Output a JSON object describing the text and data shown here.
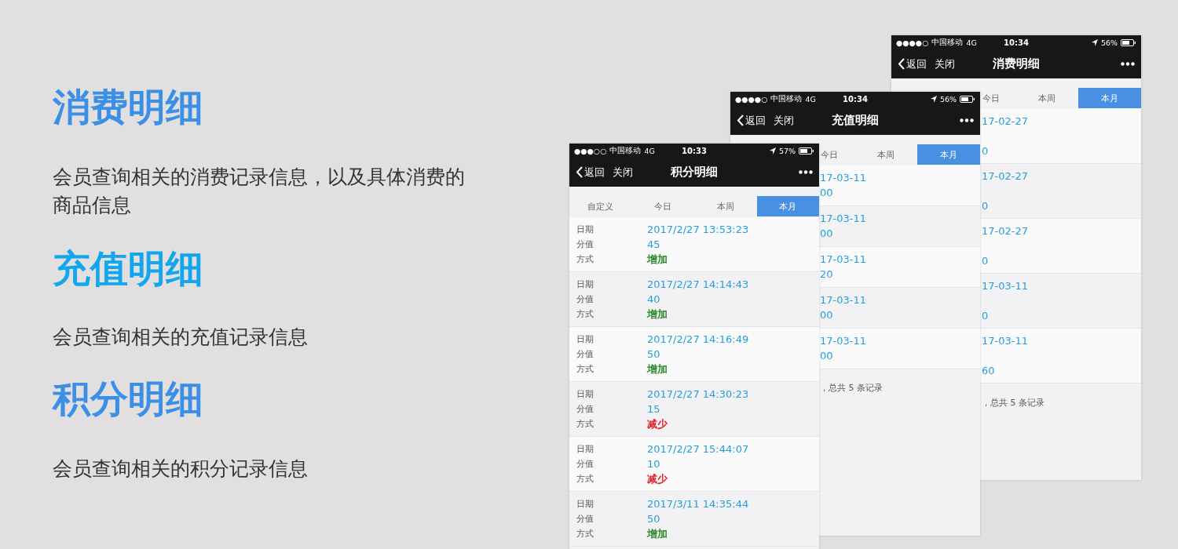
{
  "sections": [
    {
      "title": "消费明细",
      "color": "#3b8fe6",
      "description": "会员查询相关的消费记录信息，以及具体消费的商品信息"
    },
    {
      "title": "充值明细",
      "color": "#12a6ee",
      "description": "会员查询相关的充值记录信息"
    },
    {
      "title": "积分明细",
      "color": "#3b8fe6",
      "description": "会员查询相关的积分记录信息"
    }
  ],
  "phones": [
    {
      "kind": "full",
      "status": {
        "signal": "●●●○○",
        "carrier": "中国移动",
        "network": "4G",
        "time": "10:33",
        "battery": "57%"
      },
      "nav": {
        "back": "返回",
        "close": "关闭",
        "title": "积分明细"
      },
      "tabs": [
        {
          "label": "自定义",
          "selected": false
        },
        {
          "label": "今日",
          "selected": false
        },
        {
          "label": "本周",
          "selected": false
        },
        {
          "label": "本月",
          "selected": true
        }
      ],
      "records": [
        {
          "date_label": "日期",
          "date": "2017/2/27 13:53:23",
          "points_label": "分值",
          "points": "45",
          "method_label": "方式",
          "method": "增加",
          "color": "#2b8a2b"
        },
        {
          "date_label": "日期",
          "date": "2017/2/27 14:14:43",
          "points_label": "分值",
          "points": "40",
          "method_label": "方式",
          "method": "增加",
          "color": "#2b8a2b"
        },
        {
          "date_label": "日期",
          "date": "2017/2/27 14:16:49",
          "points_label": "分值",
          "points": "50",
          "method_label": "方式",
          "method": "增加",
          "color": "#2b8a2b"
        },
        {
          "date_label": "日期",
          "date": "2017/2/27 14:30:23",
          "points_label": "分值",
          "points": "15",
          "method_label": "方式",
          "method": "减少",
          "color": "#e0242b"
        },
        {
          "date_label": "日期",
          "date": "2017/2/27 15:44:07",
          "points_label": "分值",
          "points": "10",
          "method_label": "方式",
          "method": "减少",
          "color": "#e0242b"
        },
        {
          "date_label": "日期",
          "date": "2017/3/11 14:35:44",
          "points_label": "分值",
          "points": "50",
          "method_label": "方式",
          "method": "增加",
          "color": "#2b8a2b"
        }
      ]
    },
    {
      "kind": "compact",
      "status": {
        "signal": "●●●●○",
        "carrier": "中国移动",
        "network": "4G",
        "time": "10:34",
        "battery": "56%"
      },
      "nav": {
        "back": "返回",
        "close": "关闭",
        "title": "充值明细"
      },
      "tabs": [
        {
          "label": "今日",
          "selected": false
        },
        {
          "label": "本周",
          "selected": false
        },
        {
          "label": "本月",
          "selected": true
        }
      ],
      "records": [
        {
          "date": "17-03-11",
          "amount": "00"
        },
        {
          "date": "17-03-11",
          "amount": "00"
        },
        {
          "date": "17-03-11",
          "amount": "20"
        },
        {
          "date": "17-03-11",
          "amount": "00"
        },
        {
          "date": "17-03-11",
          "amount": "00"
        }
      ],
      "footer": "，总共 5 条记录"
    },
    {
      "kind": "spaced",
      "status": {
        "signal": "●●●●○",
        "carrier": "中国移动",
        "network": "4G",
        "time": "10:34",
        "battery": "56%"
      },
      "nav": {
        "back": "返回",
        "close": "关闭",
        "title": "消费明细"
      },
      "tabs": [
        {
          "label": "今日",
          "selected": false
        },
        {
          "label": "本周",
          "selected": false
        },
        {
          "label": "本月",
          "selected": true
        }
      ],
      "records": [
        {
          "date": "17-02-27",
          "amount": "0"
        },
        {
          "date": "17-02-27",
          "amount": "0"
        },
        {
          "date": "17-02-27",
          "amount": "0"
        },
        {
          "date": "17-03-11",
          "amount": "0"
        },
        {
          "date": "17-03-11",
          "amount": "60"
        }
      ],
      "footer": "，总共 5 条记录"
    }
  ]
}
